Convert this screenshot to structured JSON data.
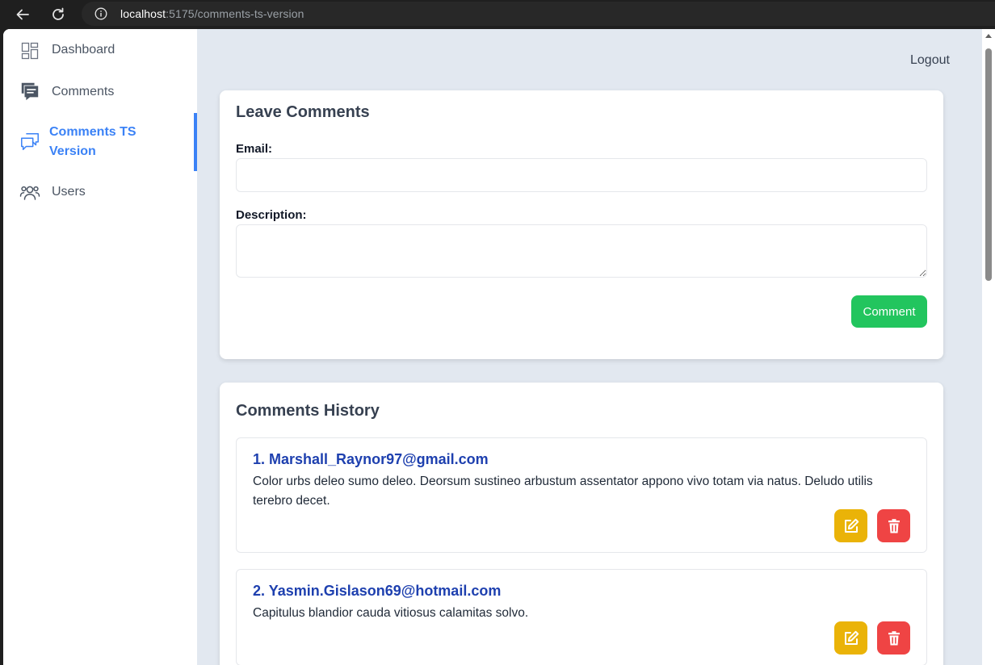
{
  "browser": {
    "url_host": "localhost",
    "url_path": ":5175/comments-ts-version"
  },
  "sidebar": {
    "items": [
      {
        "label": "Dashboard",
        "icon": "dashboard-icon",
        "active": false
      },
      {
        "label": "Comments",
        "icon": "comment-icon",
        "active": false
      },
      {
        "label": "Comments TS Version",
        "label_lines": [
          "Comments TS",
          "Version"
        ],
        "icon": "chat-bubbles-icon",
        "active": true
      },
      {
        "label": "Users",
        "icon": "users-icon",
        "active": false
      }
    ]
  },
  "header": {
    "logout_label": "Logout"
  },
  "form": {
    "title": "Leave Comments",
    "email_label": "Email:",
    "email_value": "",
    "description_label": "Description:",
    "description_value": "",
    "submit_label": "Comment"
  },
  "history": {
    "title": "Comments History",
    "items": [
      {
        "heading": "1. Marshall_Raynor97@gmail.com",
        "description": "Color urbs deleo sumo deleo. Deorsum sustineo arbustum assentator appono vivo totam via natus. Deludo utilis terebro decet."
      },
      {
        "heading": "2. Yasmin.Gislason69@hotmail.com",
        "description": "Capitulus blandior cauda vitiosus calamitas solvo."
      }
    ]
  },
  "colors": {
    "accent": "#3b82f6",
    "comment_button": "#22c55e",
    "edit_button": "#eab308",
    "delete_button": "#ef4444",
    "email_heading": "#1e40af",
    "page_background": "#e2e8f0"
  }
}
